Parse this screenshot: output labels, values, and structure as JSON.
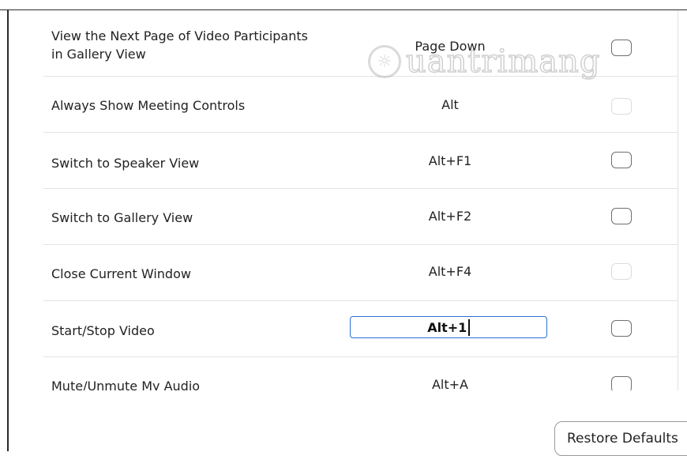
{
  "shortcuts": [
    {
      "label_line1": "View the Next Page of Video Participants",
      "label_line2": "in Gallery View",
      "shortcut": "Page Down",
      "enabled": true
    },
    {
      "label": "Always Show Meeting Controls",
      "shortcut": "Alt",
      "enabled": false
    },
    {
      "label": "Switch to Speaker View",
      "shortcut": "Alt+F1",
      "enabled": true
    },
    {
      "label": "Switch to Gallery View",
      "shortcut": "Alt+F2",
      "enabled": true
    },
    {
      "label": "Close Current Window",
      "shortcut": "Alt+F4",
      "enabled": false
    },
    {
      "label": "Start/Stop Video",
      "shortcut": "Alt+1",
      "enabled": true,
      "editing": true
    },
    {
      "label": "Mute/Unmute My Audio",
      "shortcut": "Alt+A",
      "enabled": true
    }
  ],
  "restore_defaults_label": "Restore Defaults",
  "watermark": {
    "text": "uantrimang",
    "icon": "lightbulb-icon"
  },
  "colors": {
    "focus_border": "#2b6fd4",
    "row_divider": "#e3e3e3",
    "checkbox_border": "#6f6f6f"
  }
}
